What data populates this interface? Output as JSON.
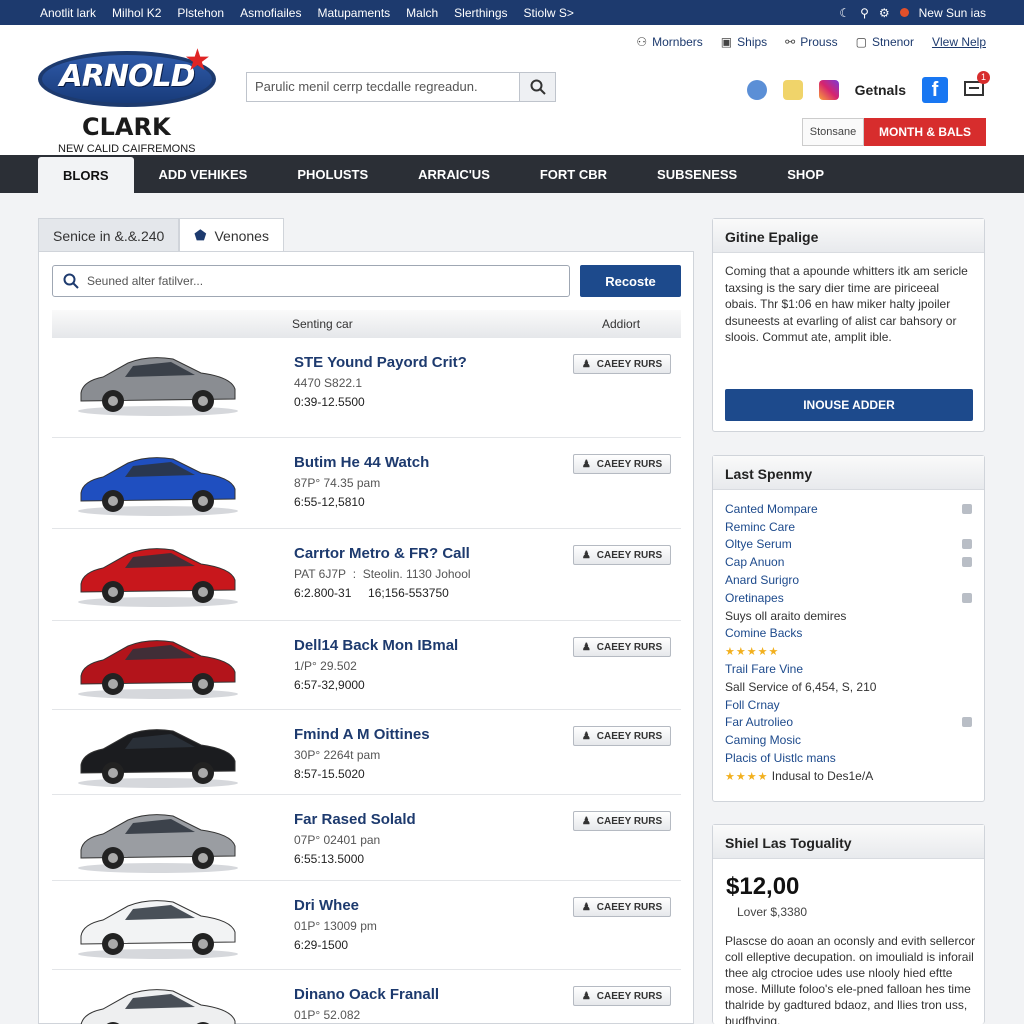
{
  "topbar": {
    "links": [
      "Anotlit lark",
      "Milhol K2",
      "Plstehon",
      "Asmofiailes",
      "Matupaments",
      "Malch",
      "Slerthings",
      "Stiolw S>"
    ],
    "right_text": "New Sun ias"
  },
  "brand": {
    "logo_top": "ARNOLD",
    "logo_bottom": "CLARK",
    "tagline": "NEW CALID CAIFREMONS"
  },
  "search": {
    "placeholder": "Parulic menil cerrp tecdalle regreadun."
  },
  "account": {
    "items": [
      {
        "label": "Mornbers",
        "icon": "user-icon"
      },
      {
        "label": "Ships",
        "icon": "ship-icon"
      },
      {
        "label": "Prouss",
        "icon": "link-icon"
      },
      {
        "label": "Stnenor",
        "icon": "box-icon"
      }
    ],
    "help_link": "Vlew Nelp"
  },
  "social": {
    "label": "Getnals",
    "badge_count": "1"
  },
  "header_buttons": {
    "light": "Stonsane",
    "red": "MONTH & BALS"
  },
  "nav": [
    "BLORS",
    "ADD VEHIKES",
    "PHOLUSTS",
    "ARRAIC'US",
    "FORT CBR",
    "SUBSENESS",
    "SHOP"
  ],
  "panel": {
    "tabs": [
      "Senice in &.&.240",
      "Venones"
    ],
    "search_placeholder": "Seuned alter fatilver...",
    "search_button": "Recoste",
    "col_car": "Senting car",
    "col_addi": "Addiort"
  },
  "listings": [
    {
      "title": "STE Yound Payord Crit?",
      "sub": "4470 S822.1",
      "price": "0:39-12.5500",
      "btn": "CAEEY RURS",
      "color": "#8a8d92"
    },
    {
      "title": "Butim He 44 Watch",
      "sub": "87P° 74.35 pam",
      "price": "6:55-12,5810",
      "btn": "CAEEY RURS",
      "color": "#1f4fc0"
    },
    {
      "title": "Carrtor Metro & FR? Call",
      "sub": "PAT 6J7P  :  Steolin. 1130 Johool",
      "price": "6:2.800-31     16;156-553750",
      "btn": "CAEEY RURS",
      "color": "#c8171c"
    },
    {
      "title": "Dell14 Back Mon IBmal",
      "sub": "1/P° 29.502",
      "price": "6:57-32,9000",
      "btn": "CAEEY RURS",
      "color": "#b3141b"
    },
    {
      "title": "Fmind A M Oittines",
      "sub": "30P° 2264t pam",
      "price": "8:57-15.5020",
      "btn": "CAEEY RURS",
      "color": "#1b1c1f"
    },
    {
      "title": "Far Rased Solald",
      "sub": "07P° 02401 pan",
      "price": "6:55:13.5000",
      "btn": "CAEEY RURS",
      "color": "#9a9da2"
    },
    {
      "title": "Dri Whee",
      "sub": "01P° 13009 pm",
      "price": "6:29-1500",
      "btn": "CAEEY RURS",
      "color": "#f2f3f4"
    },
    {
      "title": "Dinano Oack Franall",
      "sub": "01P° 52.082",
      "price": "",
      "btn": "CAEEY RURS",
      "color": "#eeeff0"
    }
  ],
  "sidebar1": {
    "title": "Gitine Epalige",
    "text": "Coming that a apounde whitters itk am sericle taxsing is the sary dier time are piriceeal obais. Thr $1:06 en haw miker halty jpoiler dsuneests at evarling of alist car bahsory or sloois. Commut ate, amplit ible.",
    "button": "INOUSE ADDER"
  },
  "sidebar2": {
    "title": "Last Spenmy",
    "items": [
      {
        "label": "Canted Mompare",
        "plain": false,
        "icon": true,
        "stars": ""
      },
      {
        "label": "Reminc Care",
        "plain": false,
        "icon": false,
        "stars": ""
      },
      {
        "label": "Oltye Serum",
        "plain": false,
        "icon": true,
        "stars": ""
      },
      {
        "label": "Cap Anuon",
        "plain": false,
        "icon": true,
        "stars": ""
      },
      {
        "label": "Anard Surigro",
        "plain": false,
        "icon": false,
        "stars": ""
      },
      {
        "label": "Oretinapes",
        "plain": false,
        "icon": true,
        "stars": ""
      },
      {
        "label": "Suys oll araito demires",
        "plain": true,
        "icon": false,
        "stars": ""
      },
      {
        "label": "Comine Backs",
        "plain": false,
        "icon": false,
        "stars": ""
      },
      {
        "label": "",
        "plain": true,
        "icon": false,
        "stars": "★★★★★"
      },
      {
        "label": "Trail Fare Vine",
        "plain": false,
        "icon": false,
        "stars": ""
      },
      {
        "label": "Sall Service of 6,454, S, 210",
        "plain": true,
        "icon": false,
        "stars": ""
      },
      {
        "label": "Foll Crnay",
        "plain": false,
        "icon": false,
        "stars": ""
      },
      {
        "label": "Far Autrolieo",
        "plain": false,
        "icon": true,
        "stars": ""
      },
      {
        "label": "Caming Mosic",
        "plain": false,
        "icon": false,
        "stars": ""
      },
      {
        "label": "Placis of Uistlc mans",
        "plain": false,
        "icon": false,
        "stars": ""
      },
      {
        "label": "Indusal to Des1e/A",
        "plain": true,
        "icon": false,
        "stars": "★★★★"
      }
    ]
  },
  "sidebar3": {
    "title": "Shiel Las Toguality",
    "price": "$12,00",
    "lower": "Lover $,3380",
    "desc": "Plascse do aoan an oconsly and evith sellercor coll elleptive decupation. on imouliald is inforail thee alg ctrocioe udes use nlooly hied eftte mose. Millute foloo's ele-pned falloan hes time thalride by gadtured bdaoz, and llies tron uss, budfhying."
  }
}
